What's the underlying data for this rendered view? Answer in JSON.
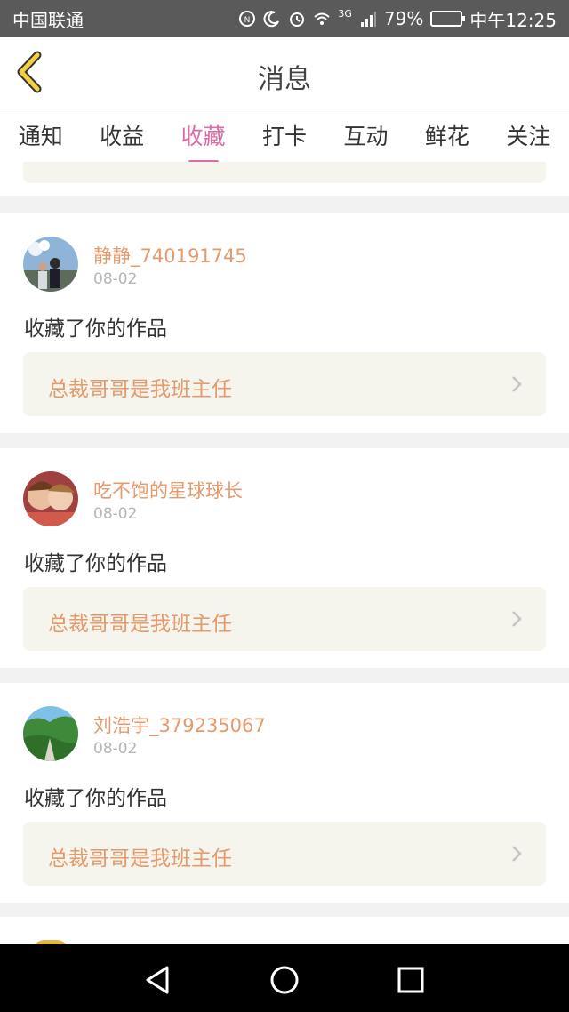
{
  "status_bar": {
    "carrier": "中国联通",
    "network": "3G",
    "battery": "79%",
    "time": "中午12:25"
  },
  "header": {
    "title": "消息",
    "back_icon": "chevron-left-icon"
  },
  "tabs": [
    {
      "label": "通知",
      "active": false
    },
    {
      "label": "收益",
      "active": false
    },
    {
      "label": "收藏",
      "active": true
    },
    {
      "label": "打卡",
      "active": false
    },
    {
      "label": "互动",
      "active": false
    },
    {
      "label": "鲜花",
      "active": false
    },
    {
      "label": "关注",
      "active": false
    }
  ],
  "items": [
    {
      "user": "静静_740191745",
      "date": "08-02",
      "action": "收藏了你的作品",
      "work_title": "总裁哥哥是我班主任"
    },
    {
      "user": "吃不饱的星球球长",
      "date": "08-02",
      "action": "收藏了你的作品",
      "work_title": "总裁哥哥是我班主任"
    },
    {
      "user": "刘浩宇_379235067",
      "date": "08-02",
      "action": "收藏了你的作品",
      "work_title": "总裁哥哥是我班主任"
    }
  ],
  "colors": {
    "accent": "#e06aa5",
    "username": "#e59a6c",
    "card_bg": "#f5f5ee"
  }
}
